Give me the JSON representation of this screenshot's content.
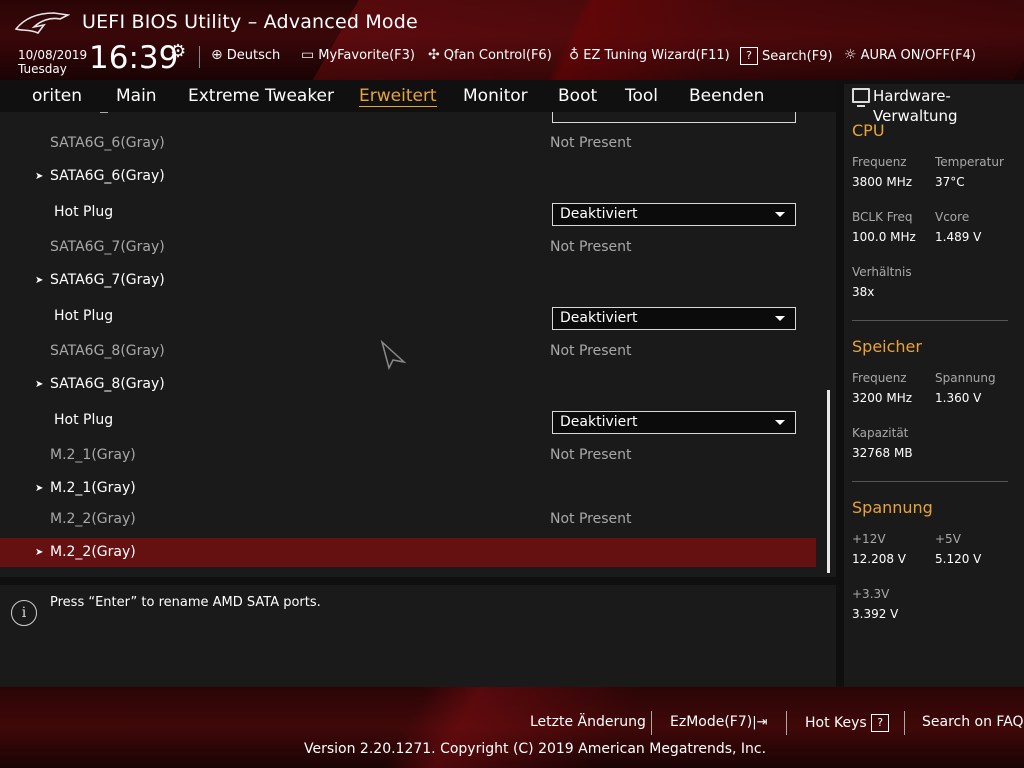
{
  "header": {
    "title": "UEFI BIOS Utility – Advanced Mode",
    "date": "10/08/2019",
    "day": "Tuesday",
    "time": "16:39",
    "buttons": [
      {
        "label": "Deutsch",
        "icon": "globe-icon"
      },
      {
        "label": "MyFavorite(F3)",
        "icon": "favorite-icon"
      },
      {
        "label": "Qfan Control(F6)",
        "icon": "fan-icon"
      },
      {
        "label": "EZ Tuning Wizard(F11)",
        "icon": "lightbulb-icon"
      },
      {
        "label": "Search(F9)",
        "icon": "question-box-icon"
      },
      {
        "label": "AURA ON/OFF(F4)",
        "icon": "aura-icon"
      }
    ]
  },
  "nav": {
    "tabs": [
      "oriten",
      "Main",
      "Extreme Tweaker",
      "Erweitert",
      "Monitor",
      "Boot",
      "Tool",
      "Beenden"
    ],
    "active": "Erweitert"
  },
  "rows": [
    {
      "label": "SATA6G_6(Gray)",
      "value": "Not Present"
    },
    {
      "label": "SATA6G_6(Gray)"
    },
    {
      "label": "Hot Plug",
      "value": "Deaktiviert"
    },
    {
      "label": "SATA6G_7(Gray)",
      "value": "Not Present"
    },
    {
      "label": "SATA6G_7(Gray)"
    },
    {
      "label": "Hot Plug",
      "value": "Deaktiviert"
    },
    {
      "label": "SATA6G_8(Gray)",
      "value": "Not Present"
    },
    {
      "label": "SATA6G_8(Gray)"
    },
    {
      "label": "Hot Plug",
      "value": "Deaktiviert"
    },
    {
      "label": "M.2_1(Gray)",
      "value": "Not Present"
    },
    {
      "label": "M.2_1(Gray)"
    },
    {
      "label": "M.2_2(Gray)",
      "value": "Not Present"
    },
    {
      "label": "M.2_2(Gray)"
    }
  ],
  "help": {
    "text": "Press “Enter” to rename AMD SATA ports."
  },
  "hardware": {
    "title": "Hardware-Verwaltung",
    "cpu": {
      "heading": "CPU",
      "freq_label": "Frequenz",
      "freq": "3800 MHz",
      "temp_label": "Temperatur",
      "temp": "37°C",
      "bclk_label": "BCLK Freq",
      "bclk": "100.0 MHz",
      "vcore_label": "Vcore",
      "vcore": "1.489 V",
      "ratio_label": "Verhältnis",
      "ratio": "38x"
    },
    "memory": {
      "heading": "Speicher",
      "freq_label": "Frequenz",
      "freq": "3200 MHz",
      "volt_label": "Spannung",
      "volt": "1.360 V",
      "cap_label": "Kapazität",
      "cap": "32768 MB"
    },
    "voltage": {
      "heading": "Spannung",
      "v12_label": "+12V",
      "v12": "12.208 V",
      "v5_label": "+5V",
      "v5": "5.120 V",
      "v33_label": "+3.3V",
      "v33": "3.392 V"
    }
  },
  "footer": {
    "last_change": "Letzte Änderung",
    "ezmode": "EzMode(F7)",
    "hotkeys": "Hot Keys",
    "faq": "Search on FAQ",
    "copyright": "Version 2.20.1271. Copyright (C) 2019 American Megatrends, Inc."
  }
}
